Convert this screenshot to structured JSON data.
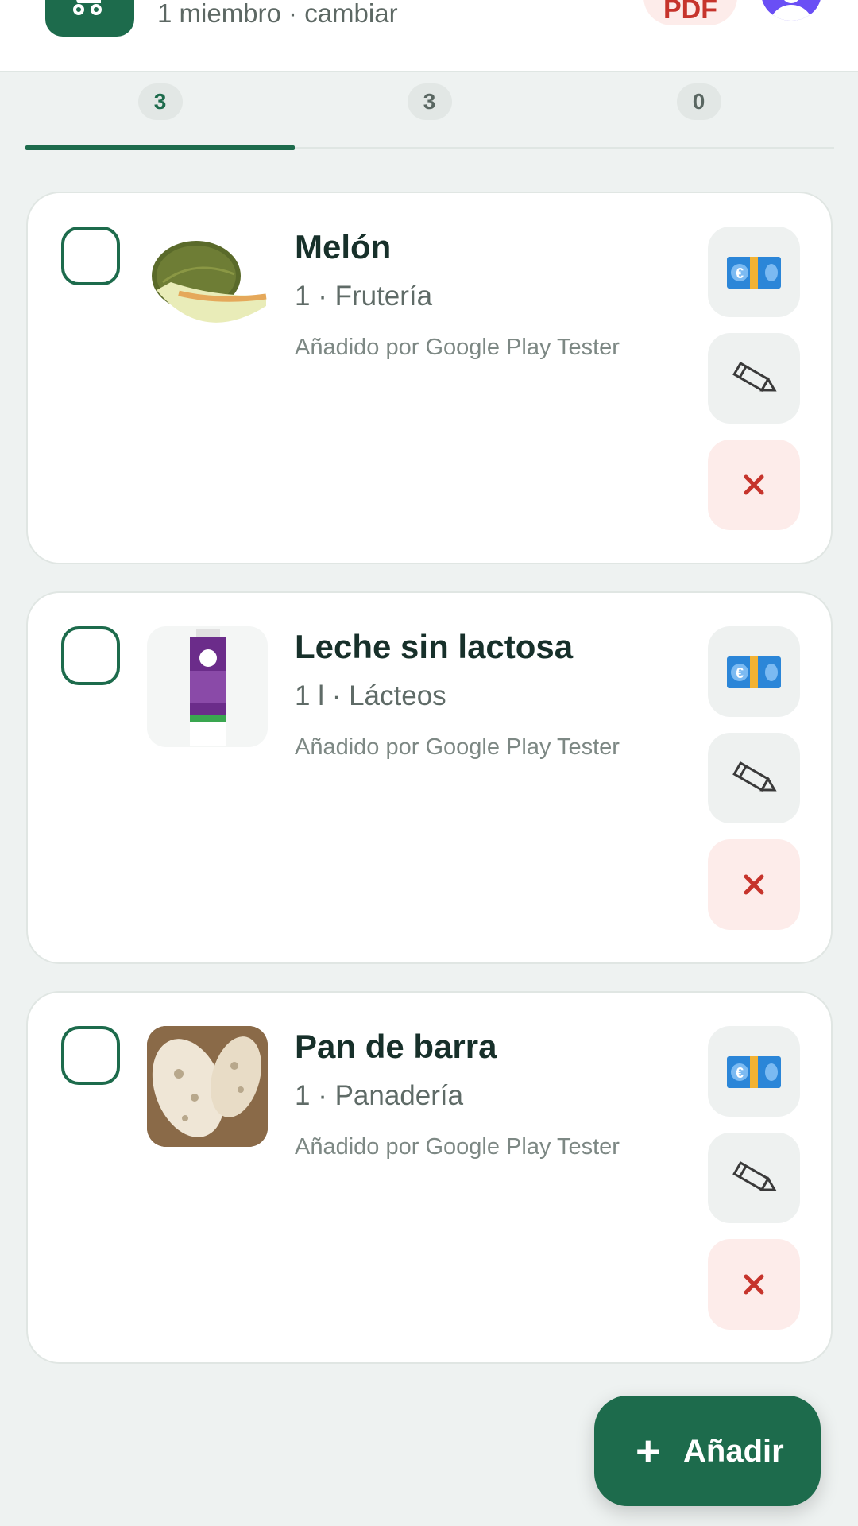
{
  "header": {
    "group_info": "1 miembro · cambiar",
    "pdf_label": "PDF"
  },
  "tabs": [
    {
      "count": "3",
      "active": true
    },
    {
      "count": "3",
      "active": false
    },
    {
      "count": "0",
      "active": false
    }
  ],
  "items": [
    {
      "name": "Melón",
      "meta": "1 · Frutería",
      "added_by": "Añadido por Google Play Tester",
      "image": "melon-photo"
    },
    {
      "name": "Leche sin lactosa",
      "meta": "1 l · Lácteos",
      "added_by": "Añadido por Google Play Tester",
      "image": "milk-carton-photo"
    },
    {
      "name": "Pan de barra",
      "meta": "1 · Panadería",
      "added_by": "Añadido por Google Play Tester",
      "image": "bread-photo"
    }
  ],
  "actions": {
    "price_icon": "euro-banknote-icon",
    "edit_icon": "pencil-icon",
    "delete_icon": "close-icon"
  },
  "fab": {
    "icon": "plus-icon",
    "label": "Añadir"
  },
  "colors": {
    "primary": "#1d6b4c",
    "delete": "#c6342c",
    "background": "#eef2f1"
  }
}
